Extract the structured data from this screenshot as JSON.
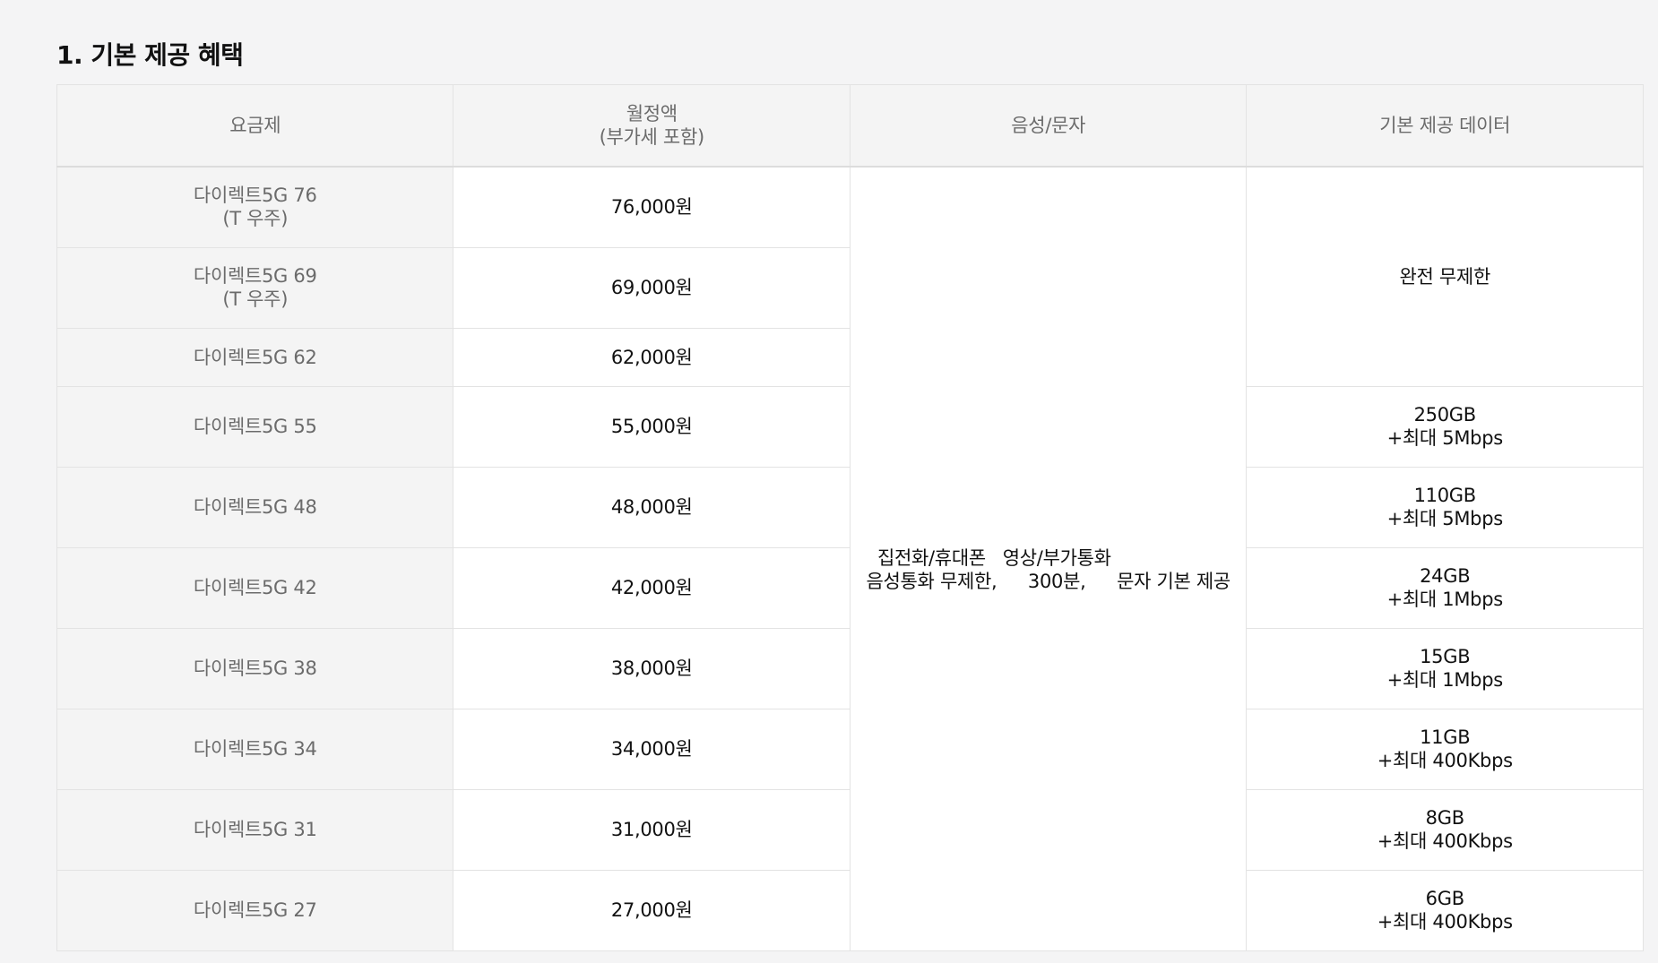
{
  "section": {
    "title": "1. 기본 제공 혜택"
  },
  "table": {
    "headers": [
      "요금제",
      "월정액\n(부가세 포함)",
      "음성/문자",
      "기본 제공 데이터"
    ],
    "rows": [
      {
        "plan": "다이렉트5G 76\n(T 우주)",
        "price": "76,000원"
      },
      {
        "plan": "다이렉트5G 69\n(T 우주)",
        "price": "69,000원"
      },
      {
        "plan": "다이렉트5G 62",
        "price": "62,000원"
      },
      {
        "plan": "다이렉트5G 55",
        "price": "55,000원"
      },
      {
        "plan": "다이렉트5G 48",
        "price": "48,000원"
      },
      {
        "plan": "다이렉트5G 42",
        "price": "42,000원"
      },
      {
        "plan": "다이렉트5G 38",
        "price": "38,000원"
      },
      {
        "plan": "다이렉트5G 34",
        "price": "34,000원"
      },
      {
        "plan": "다이렉트5G 31",
        "price": "31,000원"
      },
      {
        "plan": "다이렉트5G 27",
        "price": "27,000원"
      }
    ],
    "voice": {
      "line1": "집전화/휴대폰\n음성통화 무제한,",
      "line2": "영상/부가통화\n300분,",
      "line3": "문자 기본 제공"
    },
    "data": {
      "unlimited": "완전 무제한",
      "tiers": [
        "250GB\n+최대 5Mbps",
        "110GB\n+최대 5Mbps",
        "24GB\n+최대 1Mbps",
        "15GB\n+최대 1Mbps",
        "11GB\n+최대 400Kbps",
        "8GB\n+최대 400Kbps",
        "6GB\n+최대 400Kbps"
      ]
    }
  }
}
